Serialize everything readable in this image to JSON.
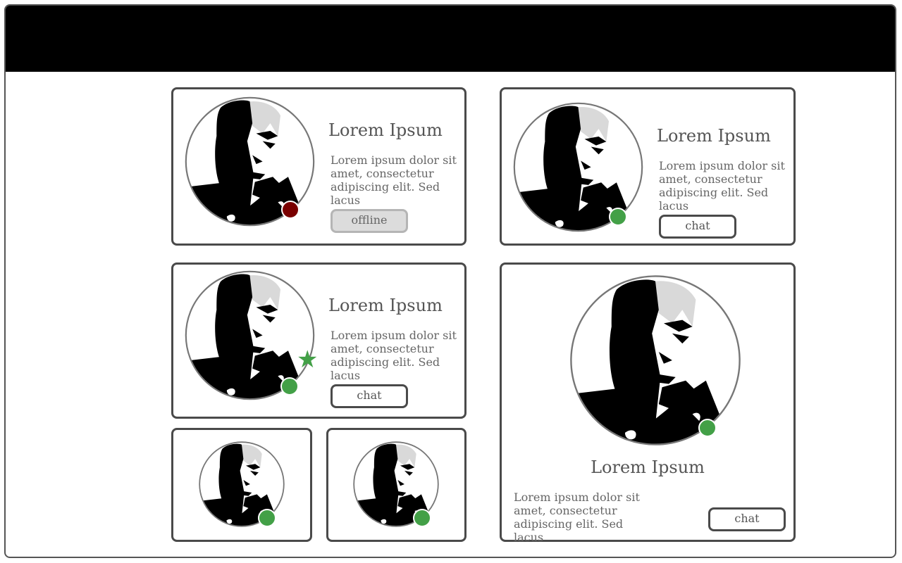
{
  "colors": {
    "online": "#43a047",
    "offline": "#7a0000",
    "header": "#000000",
    "border": "#4a4a4a"
  },
  "cards": {
    "c1": {
      "name": "Lorem Ipsum",
      "desc": "Lorem ipsum dolor sit amet, consectetur adipiscing elit. Sed lacus",
      "button": "offline",
      "status": "offline"
    },
    "c2": {
      "name": "Lorem Ipsum",
      "desc": "Lorem ipsum dolor sit amet, consectetur adipiscing elit. Sed lacus",
      "button": "chat",
      "status": "online"
    },
    "c3": {
      "name": "Lorem Ipsum",
      "desc": "Lorem ipsum dolor sit amet, consectetur adipiscing elit. Sed lacus",
      "button": "chat",
      "status": "online",
      "favorite_icon": "star-icon"
    },
    "c4": {
      "name": "Lorem Ipsum",
      "desc": "Lorem ipsum dolor sit amet, consectetur adipiscing elit. Sed lacus",
      "button": "chat",
      "status": "online"
    },
    "c5": {
      "status": "online"
    },
    "c6": {
      "status": "online"
    }
  }
}
